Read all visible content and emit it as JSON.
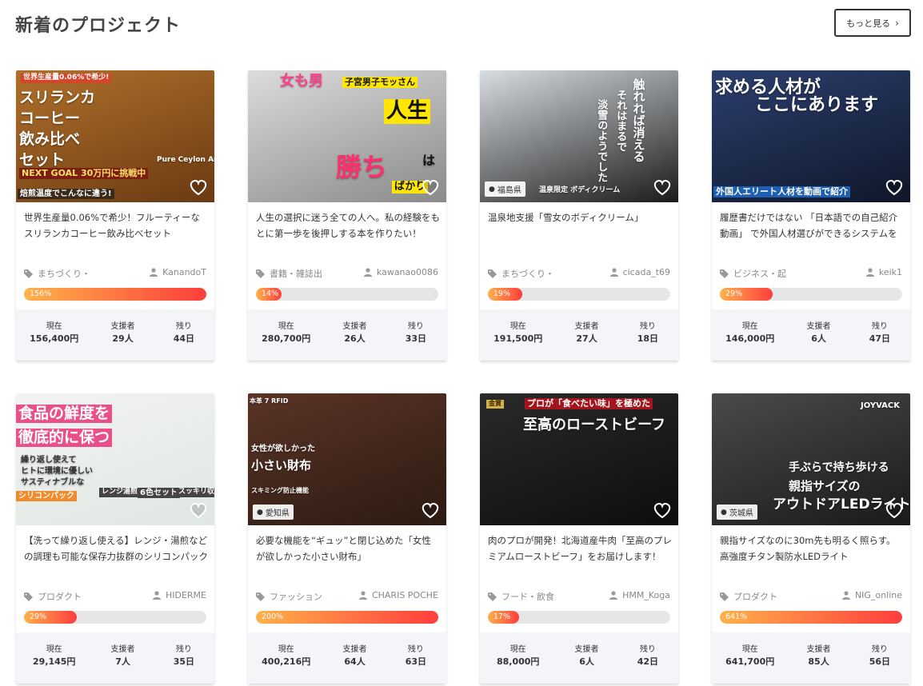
{
  "section": {
    "title": "新着のプロジェクト",
    "more_label": "もっと見る"
  },
  "labels": {
    "current": "現在",
    "supporters": "支援者",
    "remaining": "残り"
  },
  "cards": [
    {
      "title": "世界生産量0.06%で希少！フルーティーなスリランカコーヒー飲み比べセット",
      "category": "まちづくり・",
      "owner": "KanandoT",
      "percent_label": "156%",
      "progress_percent": 156,
      "current": "156,400円",
      "supporters": "29人",
      "remaining": "44日",
      "prefecture": "",
      "image": {
        "colors": [
          "#b0702a",
          "#6a3a12"
        ],
        "lines": [
          {
            "text": "世界生産量0.06%で希少!",
            "color": "#ffffff",
            "bg": "#d4462a"
          },
          {
            "text": "スリランカ",
            "color": "#ffffff",
            "bg": ""
          },
          {
            "text": "コーヒー",
            "color": "#ffffff",
            "bg": ""
          },
          {
            "text": "飲み比べ",
            "color": "#ffffff",
            "bg": ""
          },
          {
            "text": "セット",
            "color": "#ffffff",
            "bg": ""
          },
          {
            "text": "NEXT GOAL 30万円に挑戦中",
            "color": "#ffe066",
            "bg": "#7a1f12"
          },
          {
            "text": "Pure Ceylon Arabica",
            "color": "#ffffff",
            "bg": ""
          },
          {
            "text": "焙煎温度でこんなに違う!",
            "color": "#ffffff",
            "bg": "#3a2a1a"
          }
        ]
      }
    },
    {
      "title": "人生の選択に迷う全ての人へ。私の経験をもとに第一歩を後押しする本を作りたい！",
      "category": "書籍・雑誌出",
      "owner": "kawanao0086",
      "percent_label": "14%",
      "progress_percent": 14,
      "current": "280,700円",
      "supporters": "26人",
      "remaining": "33日",
      "prefecture": "",
      "image": {
        "colors": [
          "#dcdcdc",
          "#8a8a8a"
        ],
        "lines": [
          {
            "text": "女も男",
            "color": "#ff3d8b",
            "bg": ""
          },
          {
            "text": "子宮男子モッさん",
            "color": "#111111",
            "bg": "#ffe600"
          },
          {
            "text": "人生",
            "color": "#111111",
            "bg": "#ffe600"
          },
          {
            "text": "は",
            "color": "#111111",
            "bg": ""
          },
          {
            "text": "勝ち",
            "color": "#ff2f6e",
            "bg": ""
          },
          {
            "text": "ばかり",
            "color": "#111111",
            "bg": "#ffe600"
          }
        ]
      }
    },
    {
      "title": "温泉地支援「雪女のボディクリーム」",
      "category": "まちづくり・",
      "owner": "cicada_t69",
      "percent_label": "19%",
      "progress_percent": 19,
      "current": "191,500円",
      "supporters": "27人",
      "remaining": "18日",
      "prefecture": "福島県",
      "image": {
        "colors": [
          "#d8dde2",
          "#1a1a1a"
        ],
        "lines": [
          {
            "text": "触れれば消える",
            "color": "#ffffff",
            "bg": ""
          },
          {
            "text": "それはまるで",
            "color": "#ffffff",
            "bg": ""
          },
          {
            "text": "淡雪のようでした",
            "color": "#ffffff",
            "bg": ""
          },
          {
            "text": "温泉限定 ボディクリーム",
            "color": "#ffffff",
            "bg": ""
          }
        ]
      }
    },
    {
      "title": "履歴書だけではない 「日本語での自己紹介動画」 で外国人材選びができるシステムを",
      "category": "ビジネス・起",
      "owner": "keik1",
      "percent_label": "29%",
      "progress_percent": 29,
      "current": "146,000円",
      "supporters": "6人",
      "remaining": "47日",
      "prefecture": "",
      "image": {
        "colors": [
          "#2b3f6e",
          "#0f1629"
        ],
        "lines": [
          {
            "text": "求める人材が",
            "color": "#ffffff",
            "bg": ""
          },
          {
            "text": "ここにあります",
            "color": "#ffffff",
            "bg": ""
          },
          {
            "text": "外国人エリート人材を動画で紹介",
            "color": "#ffffff",
            "bg": "#1d5fb0"
          }
        ]
      }
    },
    {
      "title": "【洗って繰り返し使える】レンジ・湯煎などの調理も可能な保存力抜群のシリコンパック",
      "category": "プロダクト",
      "owner": "HIDERME",
      "percent_label": "29%",
      "progress_percent": 29,
      "current": "29,145円",
      "supporters": "7人",
      "remaining": "35日",
      "prefecture": "",
      "image": {
        "colors": [
          "#f3f3f3",
          "#dfe7e2"
        ],
        "lines": [
          {
            "text": "食品の鮮度を",
            "color": "#ffffff",
            "bg": "#e9508a"
          },
          {
            "text": "徹底的に保つ",
            "color": "#ffffff",
            "bg": "#e9508a"
          },
          {
            "text": "繰り返し使えて",
            "color": "#333333",
            "bg": ""
          },
          {
            "text": "ヒトに環境に優しい",
            "color": "#333333",
            "bg": ""
          },
          {
            "text": "サスティナブルな",
            "color": "#333333",
            "bg": ""
          },
          {
            "text": "シリコンパック",
            "color": "#ffffff",
            "bg": "#f08a2a"
          },
          {
            "text": "レンジ湯煎OK",
            "color": "#ffffff",
            "bg": "#444444"
          },
          {
            "text": "6色セット",
            "color": "#ffffff",
            "bg": "#444444"
          },
          {
            "text": "スッキリ収納",
            "color": "#ffffff",
            "bg": "#444444"
          }
        ]
      }
    },
    {
      "title": "必要な機能を“ギュッ”と閉じ込めた「女性が欲しかった小さい財布」",
      "category": "ファッション",
      "owner": "CHARIS POCHE",
      "percent_label": "200%",
      "progress_percent": 200,
      "current": "400,216円",
      "supporters": "64人",
      "remaining": "63日",
      "prefecture": "愛知県",
      "image": {
        "colors": [
          "#5a3426",
          "#2c1a12"
        ],
        "lines": [
          {
            "text": "本革 7 RFID",
            "color": "#ffffff",
            "bg": ""
          },
          {
            "text": "女性が欲しかった",
            "color": "#ffffff",
            "bg": ""
          },
          {
            "text": "小さい財布",
            "color": "#ffffff",
            "bg": ""
          },
          {
            "text": "スキミング防止機能",
            "color": "#ffffff",
            "bg": ""
          }
        ]
      }
    },
    {
      "title": "肉のプロが開発！北海道産牛肉「至高のプレミアムローストビーフ」をお届けします！",
      "category": "フード・飲食",
      "owner": "HMM_Koga",
      "percent_label": "17%",
      "progress_percent": 17,
      "current": "88,000円",
      "supporters": "6人",
      "remaining": "42日",
      "prefecture": "",
      "image": {
        "colors": [
          "#2a2a2a",
          "#0d0d0d"
        ],
        "lines": [
          {
            "text": "プロが「食べたい味」を極めた",
            "color": "#ffffff",
            "bg": "#a3141c"
          },
          {
            "text": "至高のローストビーフ",
            "color": "#ffffff",
            "bg": ""
          },
          {
            "text": "金賞",
            "color": "#3a2a00",
            "bg": "#d4b04a"
          }
        ]
      }
    },
    {
      "title": "親指サイズなのに30m先も明るく照らす。高強度チタン製防水LEDライト",
      "category": "プロダクト",
      "owner": "NIG_online",
      "percent_label": "641%",
      "progress_percent": 641,
      "current": "641,700円",
      "supporters": "85人",
      "remaining": "56日",
      "prefecture": "茨城県",
      "image": {
        "colors": [
          "#4a4a4a",
          "#1a1a1a"
        ],
        "lines": [
          {
            "text": "JOYVACK",
            "color": "#ffffff",
            "bg": ""
          },
          {
            "text": "手ぶらで持ち歩ける",
            "color": "#ffffff",
            "bg": ""
          },
          {
            "text": "親指サイズの",
            "color": "#ffffff",
            "bg": ""
          },
          {
            "text": "アウトドアLEDライト",
            "color": "#ffffff",
            "bg": ""
          }
        ]
      }
    }
  ]
}
